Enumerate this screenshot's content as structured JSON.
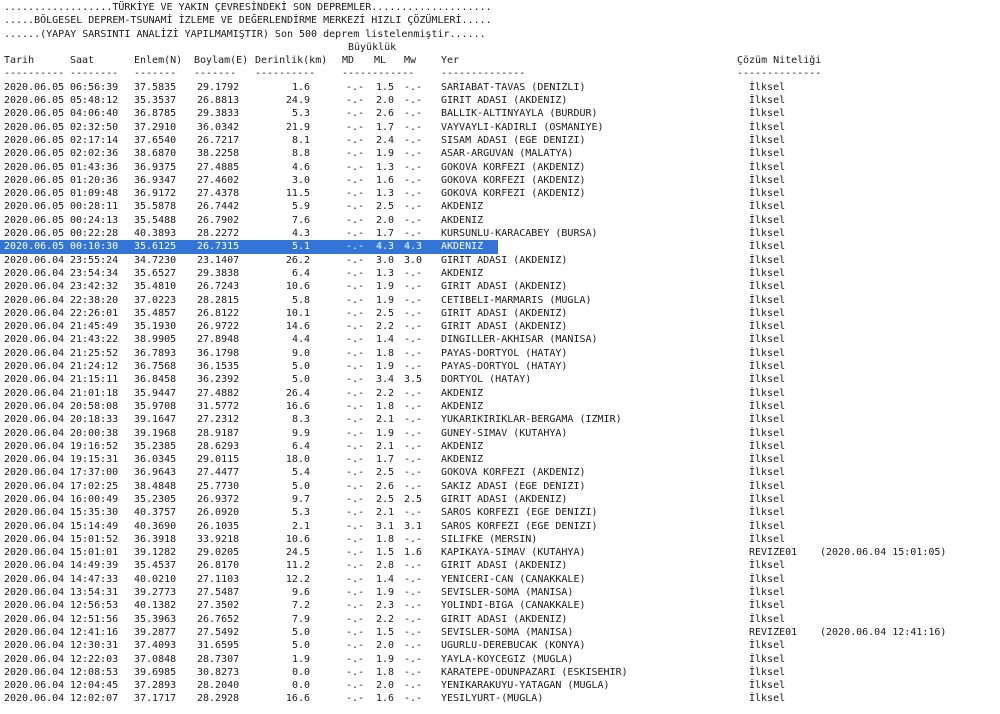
{
  "header": {
    "line1": "..................TÜRKİYE VE YAKIN ÇEVRESİNDEKİ SON DEPREMLER....................",
    "line2": ".....BÖLGESEL DEPREM-TSUNAMİ İZLEME VE DEĞERLENDİRME MERKEZİ HIZLI ÇÖZÜMLERİ.....",
    "line3": "......(YAPAY SARSINTI ANALİZİ YAPILMAMIŞTIR) Son 500 deprem listelenmiştir......",
    "magnitude_label": "Büyüklük"
  },
  "columns": {
    "date": "Tarih",
    "time": "Saat",
    "lat": "Enlem(N)",
    "lon": "Boylam(E)",
    "depth": "Derinlik(km)",
    "md": "MD",
    "ml": "ML",
    "mw": "Mw",
    "place": "Yer",
    "quality": "Çözüm Niteliği"
  },
  "rules": {
    "date": "----------",
    "time": "--------",
    "lat": "-------",
    "lon": "-------",
    "depth": "----------",
    "mag": "------------",
    "place": "--------------",
    "quality": "--------------"
  },
  "selected_index": 12,
  "rows": [
    {
      "date": "2020.06.05",
      "time": "06:56:39",
      "lat": "37.5835",
      "lon": "29.1792",
      "depth": "1.6",
      "md": "-.-",
      "ml": "1.5",
      "mw": "-.-",
      "place": "SARIABAT-TAVAS (DENIZLI)",
      "quality": "İlksel",
      "revise_time": ""
    },
    {
      "date": "2020.06.05",
      "time": "05:48:12",
      "lat": "35.3537",
      "lon": "26.8813",
      "depth": "24.9",
      "md": "-.-",
      "ml": "2.0",
      "mw": "-.-",
      "place": "GIRIT ADASI (AKDENIZ)",
      "quality": "İlksel",
      "revise_time": ""
    },
    {
      "date": "2020.06.05",
      "time": "04:06:40",
      "lat": "36.8785",
      "lon": "29.3833",
      "depth": "5.3",
      "md": "-.-",
      "ml": "2.6",
      "mw": "-.-",
      "place": "BALLIK-ALTINYAYLA (BURDUR)",
      "quality": "İlksel",
      "revise_time": ""
    },
    {
      "date": "2020.06.05",
      "time": "02:32:50",
      "lat": "37.2910",
      "lon": "36.0342",
      "depth": "21.9",
      "md": "-.-",
      "ml": "1.7",
      "mw": "-.-",
      "place": "VAYVAYLI-KADIRLI (OSMANIYE)",
      "quality": "İlksel",
      "revise_time": ""
    },
    {
      "date": "2020.06.05",
      "time": "02:17:14",
      "lat": "37.6540",
      "lon": "26.7217",
      "depth": "8.1",
      "md": "-.-",
      "ml": "2.4",
      "mw": "-.-",
      "place": "SISAM ADASI (EGE DENIZI)",
      "quality": "İlksel",
      "revise_time": ""
    },
    {
      "date": "2020.06.05",
      "time": "02:02:36",
      "lat": "38.6870",
      "lon": "38.2258",
      "depth": "8.8",
      "md": "-.-",
      "ml": "1.9",
      "mw": "-.-",
      "place": "ASAR-ARGUVAN (MALATYA)",
      "quality": "İlksel",
      "revise_time": ""
    },
    {
      "date": "2020.06.05",
      "time": "01:43:36",
      "lat": "36.9375",
      "lon": "27.4885",
      "depth": "4.6",
      "md": "-.-",
      "ml": "1.3",
      "mw": "-.-",
      "place": "GOKOVA KORFEZI (AKDENIZ)",
      "quality": "İlksel",
      "revise_time": ""
    },
    {
      "date": "2020.06.05",
      "time": "01:20:36",
      "lat": "36.9347",
      "lon": "27.4602",
      "depth": "3.0",
      "md": "-.-",
      "ml": "1.6",
      "mw": "-.-",
      "place": "GOKOVA KORFEZI (AKDENIZ)",
      "quality": "İlksel",
      "revise_time": ""
    },
    {
      "date": "2020.06.05",
      "time": "01:09:48",
      "lat": "36.9172",
      "lon": "27.4378",
      "depth": "11.5",
      "md": "-.-",
      "ml": "1.3",
      "mw": "-.-",
      "place": "GOKOVA KORFEZI (AKDENIZ)",
      "quality": "İlksel",
      "revise_time": ""
    },
    {
      "date": "2020.06.05",
      "time": "00:28:11",
      "lat": "35.5878",
      "lon": "26.7442",
      "depth": "5.9",
      "md": "-.-",
      "ml": "2.5",
      "mw": "-.-",
      "place": "AKDENIZ",
      "quality": "İlksel",
      "revise_time": ""
    },
    {
      "date": "2020.06.05",
      "time": "00:24:13",
      "lat": "35.5488",
      "lon": "26.7902",
      "depth": "7.6",
      "md": "-.-",
      "ml": "2.0",
      "mw": "-.-",
      "place": "AKDENIZ",
      "quality": "İlksel",
      "revise_time": ""
    },
    {
      "date": "2020.06.05",
      "time": "00:22:28",
      "lat": "40.3893",
      "lon": "28.2272",
      "depth": "4.3",
      "md": "-.-",
      "ml": "1.7",
      "mw": "-.-",
      "place": "KURSUNLU-KARACABEY (BURSA)",
      "quality": "İlksel",
      "revise_time": ""
    },
    {
      "date": "2020.06.05",
      "time": "00:10:30",
      "lat": "35.6125",
      "lon": "26.7315",
      "depth": "5.1",
      "md": "-.-",
      "ml": "4.3",
      "mw": "4.3",
      "place": "AKDENIZ",
      "quality": "İlksel",
      "revise_time": ""
    },
    {
      "date": "2020.06.04",
      "time": "23:55:24",
      "lat": "34.7230",
      "lon": "23.1407",
      "depth": "26.2",
      "md": "-.-",
      "ml": "3.0",
      "mw": "3.0",
      "place": "GIRIT ADASI (AKDENIZ)",
      "quality": "İlksel",
      "revise_time": ""
    },
    {
      "date": "2020.06.04",
      "time": "23:54:34",
      "lat": "35.6527",
      "lon": "29.3838",
      "depth": "6.4",
      "md": "-.-",
      "ml": "1.3",
      "mw": "-.-",
      "place": "AKDENIZ",
      "quality": "İlksel",
      "revise_time": ""
    },
    {
      "date": "2020.06.04",
      "time": "23:42:32",
      "lat": "35.4810",
      "lon": "26.7243",
      "depth": "10.6",
      "md": "-.-",
      "ml": "1.9",
      "mw": "-.-",
      "place": "GIRIT ADASI (AKDENIZ)",
      "quality": "İlksel",
      "revise_time": ""
    },
    {
      "date": "2020.06.04",
      "time": "22:38:20",
      "lat": "37.0223",
      "lon": "28.2815",
      "depth": "5.8",
      "md": "-.-",
      "ml": "1.9",
      "mw": "-.-",
      "place": "CETIBELI-MARMARIS (MUGLA)",
      "quality": "İlksel",
      "revise_time": ""
    },
    {
      "date": "2020.06.04",
      "time": "22:26:01",
      "lat": "35.4857",
      "lon": "26.8122",
      "depth": "10.1",
      "md": "-.-",
      "ml": "2.5",
      "mw": "-.-",
      "place": "GIRIT ADASI (AKDENIZ)",
      "quality": "İlksel",
      "revise_time": ""
    },
    {
      "date": "2020.06.04",
      "time": "21:45:49",
      "lat": "35.1930",
      "lon": "26.9722",
      "depth": "14.6",
      "md": "-.-",
      "ml": "2.2",
      "mw": "-.-",
      "place": "GIRIT ADASI (AKDENIZ)",
      "quality": "İlksel",
      "revise_time": ""
    },
    {
      "date": "2020.06.04",
      "time": "21:43:22",
      "lat": "38.9905",
      "lon": "27.8948",
      "depth": "4.4",
      "md": "-.-",
      "ml": "1.4",
      "mw": "-.-",
      "place": "DINGILLER-AKHISAR (MANISA)",
      "quality": "İlksel",
      "revise_time": ""
    },
    {
      "date": "2020.06.04",
      "time": "21:25:52",
      "lat": "36.7893",
      "lon": "36.1798",
      "depth": "9.0",
      "md": "-.-",
      "ml": "1.8",
      "mw": "-.-",
      "place": "PAYAS-DORTYOL (HATAY)",
      "quality": "İlksel",
      "revise_time": ""
    },
    {
      "date": "2020.06.04",
      "time": "21:24:12",
      "lat": "36.7568",
      "lon": "36.1535",
      "depth": "5.0",
      "md": "-.-",
      "ml": "1.9",
      "mw": "-.-",
      "place": "PAYAS-DORTYOL (HATAY)",
      "quality": "İlksel",
      "revise_time": ""
    },
    {
      "date": "2020.06.04",
      "time": "21:15:11",
      "lat": "36.8458",
      "lon": "36.2392",
      "depth": "5.0",
      "md": "-.-",
      "ml": "3.4",
      "mw": "3.5",
      "place": "DORTYOL (HATAY)",
      "quality": "İlksel",
      "revise_time": ""
    },
    {
      "date": "2020.06.04",
      "time": "21:01:18",
      "lat": "35.9447",
      "lon": "27.4882",
      "depth": "26.4",
      "md": "-.-",
      "ml": "2.2",
      "mw": "-.-",
      "place": "AKDENIZ",
      "quality": "İlksel",
      "revise_time": ""
    },
    {
      "date": "2020.06.04",
      "time": "20:58:08",
      "lat": "35.9708",
      "lon": "31.5772",
      "depth": "16.6",
      "md": "-.-",
      "ml": "1.8",
      "mw": "-.-",
      "place": "AKDENIZ",
      "quality": "İlksel",
      "revise_time": ""
    },
    {
      "date": "2020.06.04",
      "time": "20:18:33",
      "lat": "39.1647",
      "lon": "27.2312",
      "depth": "8.3",
      "md": "-.-",
      "ml": "2.1",
      "mw": "-.-",
      "place": "YUKARIKIRIKLAR-BERGAMA (IZMIR)",
      "quality": "İlksel",
      "revise_time": ""
    },
    {
      "date": "2020.06.04",
      "time": "20:00:38",
      "lat": "39.1968",
      "lon": "28.9187",
      "depth": "9.9",
      "md": "-.-",
      "ml": "1.9",
      "mw": "-.-",
      "place": "GUNEY-SIMAV (KUTAHYA)",
      "quality": "İlksel",
      "revise_time": ""
    },
    {
      "date": "2020.06.04",
      "time": "19:16:52",
      "lat": "35.2385",
      "lon": "28.6293",
      "depth": "6.4",
      "md": "-.-",
      "ml": "2.1",
      "mw": "-.-",
      "place": "AKDENIZ",
      "quality": "İlksel",
      "revise_time": ""
    },
    {
      "date": "2020.06.04",
      "time": "19:15:31",
      "lat": "36.0345",
      "lon": "29.0115",
      "depth": "18.0",
      "md": "-.-",
      "ml": "1.7",
      "mw": "-.-",
      "place": "AKDENIZ",
      "quality": "İlksel",
      "revise_time": ""
    },
    {
      "date": "2020.06.04",
      "time": "17:37:00",
      "lat": "36.9643",
      "lon": "27.4477",
      "depth": "5.4",
      "md": "-.-",
      "ml": "2.5",
      "mw": "-.-",
      "place": "GOKOVA KORFEZI (AKDENIZ)",
      "quality": "İlksel",
      "revise_time": ""
    },
    {
      "date": "2020.06.04",
      "time": "17:02:25",
      "lat": "38.4848",
      "lon": "25.7730",
      "depth": "5.0",
      "md": "-.-",
      "ml": "2.6",
      "mw": "-.-",
      "place": "SAKIZ ADASI (EGE DENIZI)",
      "quality": "İlksel",
      "revise_time": ""
    },
    {
      "date": "2020.06.04",
      "time": "16:00:49",
      "lat": "35.2305",
      "lon": "26.9372",
      "depth": "9.7",
      "md": "-.-",
      "ml": "2.5",
      "mw": "2.5",
      "place": "GIRIT ADASI (AKDENIZ)",
      "quality": "İlksel",
      "revise_time": ""
    },
    {
      "date": "2020.06.04",
      "time": "15:35:30",
      "lat": "40.3757",
      "lon": "26.0920",
      "depth": "5.3",
      "md": "-.-",
      "ml": "2.1",
      "mw": "-.-",
      "place": "SAROS KORFEZI (EGE DENIZI)",
      "quality": "İlksel",
      "revise_time": ""
    },
    {
      "date": "2020.06.04",
      "time": "15:14:49",
      "lat": "40.3690",
      "lon": "26.1035",
      "depth": "2.1",
      "md": "-.-",
      "ml": "3.1",
      "mw": "3.1",
      "place": "SAROS KORFEZI (EGE DENIZI)",
      "quality": "İlksel",
      "revise_time": ""
    },
    {
      "date": "2020.06.04",
      "time": "15:01:52",
      "lat": "36.3918",
      "lon": "33.9218",
      "depth": "10.6",
      "md": "-.-",
      "ml": "1.8",
      "mw": "-.-",
      "place": "SILIFKE (MERSIN)",
      "quality": "İlksel",
      "revise_time": ""
    },
    {
      "date": "2020.06.04",
      "time": "15:01:01",
      "lat": "39.1282",
      "lon": "29.0205",
      "depth": "24.5",
      "md": "-.-",
      "ml": "1.5",
      "mw": "1.6",
      "place": "KAPIKAYA-SIMAV (KUTAHYA)",
      "quality": "REVIZE01",
      "revise_time": "(2020.06.04 15:01:05)"
    },
    {
      "date": "2020.06.04",
      "time": "14:49:39",
      "lat": "35.4537",
      "lon": "26.8170",
      "depth": "11.2",
      "md": "-.-",
      "ml": "2.8",
      "mw": "-.-",
      "place": "GIRIT ADASI (AKDENIZ)",
      "quality": "İlksel",
      "revise_time": ""
    },
    {
      "date": "2020.06.04",
      "time": "14:47:33",
      "lat": "40.0210",
      "lon": "27.1103",
      "depth": "12.2",
      "md": "-.-",
      "ml": "1.4",
      "mw": "-.-",
      "place": "YENICERI-CAN (CANAKKALE)",
      "quality": "İlksel",
      "revise_time": ""
    },
    {
      "date": "2020.06.04",
      "time": "13:54:31",
      "lat": "39.2773",
      "lon": "27.5487",
      "depth": "9.6",
      "md": "-.-",
      "ml": "1.9",
      "mw": "-.-",
      "place": "SEVISLER-SOMA (MANISA)",
      "quality": "İlksel",
      "revise_time": ""
    },
    {
      "date": "2020.06.04",
      "time": "12:56:53",
      "lat": "40.1382",
      "lon": "27.3502",
      "depth": "7.2",
      "md": "-.-",
      "ml": "2.3",
      "mw": "-.-",
      "place": "YOLINDI-BIGA (CANAKKALE)",
      "quality": "İlksel",
      "revise_time": ""
    },
    {
      "date": "2020.06.04",
      "time": "12:51:56",
      "lat": "35.3963",
      "lon": "26.7652",
      "depth": "7.9",
      "md": "-.-",
      "ml": "2.2",
      "mw": "-.-",
      "place": "GIRIT ADASI (AKDENIZ)",
      "quality": "İlksel",
      "revise_time": ""
    },
    {
      "date": "2020.06.04",
      "time": "12:41:16",
      "lat": "39.2877",
      "lon": "27.5492",
      "depth": "5.0",
      "md": "-.-",
      "ml": "1.5",
      "mw": "-.-",
      "place": "SEVISLER-SOMA (MANISA)",
      "quality": "REVIZE01",
      "revise_time": "(2020.06.04 12:41:16)"
    },
    {
      "date": "2020.06.04",
      "time": "12:30:31",
      "lat": "37.4093",
      "lon": "31.6595",
      "depth": "5.0",
      "md": "-.-",
      "ml": "2.0",
      "mw": "-.-",
      "place": "UGURLU-DEREBUCAK (KONYA)",
      "quality": "İlksel",
      "revise_time": ""
    },
    {
      "date": "2020.06.04",
      "time": "12:22:03",
      "lat": "37.0848",
      "lon": "28.7307",
      "depth": "1.9",
      "md": "-.-",
      "ml": "1.9",
      "mw": "-.-",
      "place": "YAYLA-KOYCEGIZ (MUGLA)",
      "quality": "İlksel",
      "revise_time": ""
    },
    {
      "date": "2020.06.04",
      "time": "12:08:53",
      "lat": "39.6985",
      "lon": "30.8273",
      "depth": "0.0",
      "md": "-.-",
      "ml": "1.8",
      "mw": "-.-",
      "place": "KARATEPE-ODUNPAZARI (ESKISEHIR)",
      "quality": "İlksel",
      "revise_time": ""
    },
    {
      "date": "2020.06.04",
      "time": "12:04:45",
      "lat": "37.2893",
      "lon": "28.2040",
      "depth": "0.0",
      "md": "-.-",
      "ml": "2.0",
      "mw": "-.-",
      "place": "YENIKARAKUYU-YATAGAN (MUGLA)",
      "quality": "İlksel",
      "revise_time": ""
    },
    {
      "date": "2020.06.04",
      "time": "12:02:07",
      "lat": "37.1717",
      "lon": "28.2928",
      "depth": "16.6",
      "md": "-.-",
      "ml": "1.6",
      "mw": "-.-",
      "place": "YESILYURT-(MUGLA)",
      "quality": "İlksel",
      "revise_time": ""
    }
  ]
}
